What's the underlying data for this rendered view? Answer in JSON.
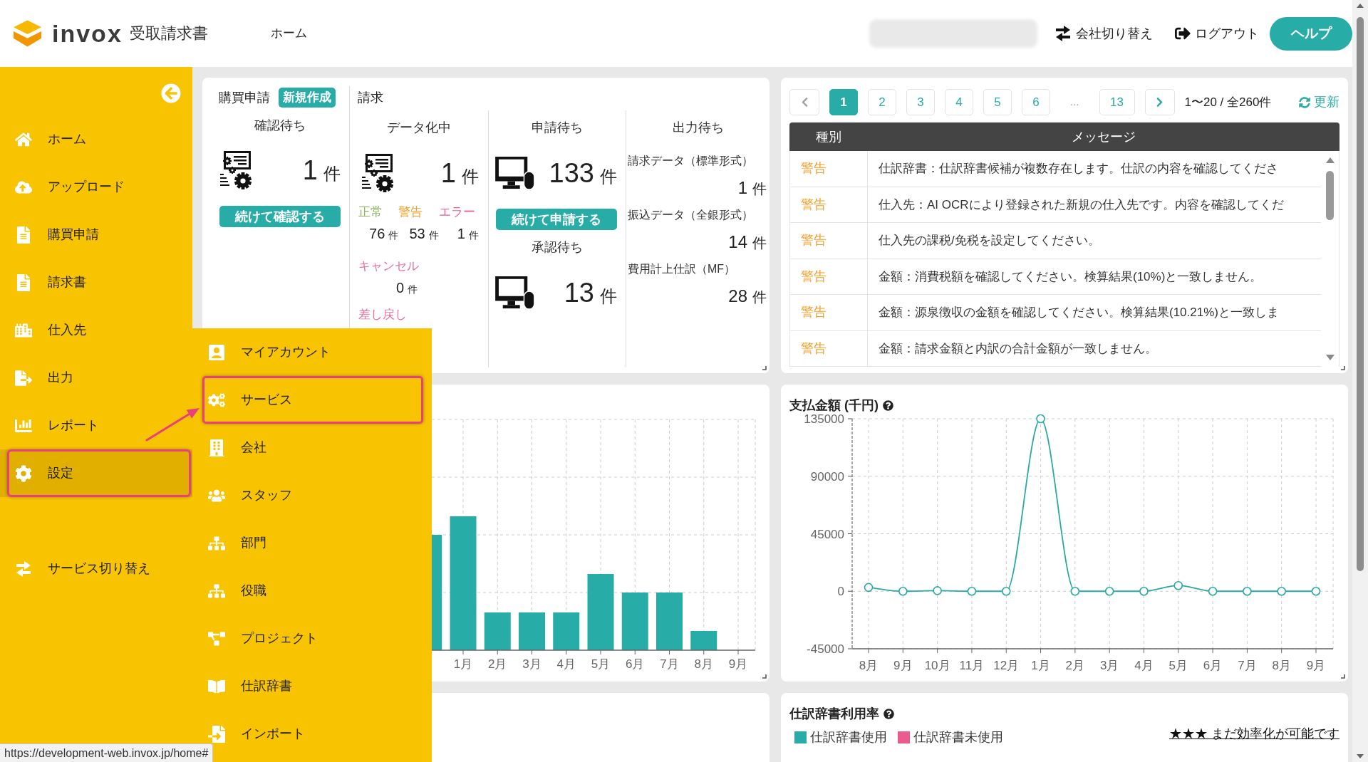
{
  "header": {
    "logo": {
      "wordmark": "invox",
      "product": "受取請求書"
    },
    "nav": [
      {
        "label": "ホーム"
      }
    ],
    "actions": [
      {
        "kind": "switch",
        "label": "会社切り替え"
      },
      {
        "kind": "logout",
        "label": "ログアウト"
      }
    ],
    "help_button": "ヘルプ"
  },
  "sidebar": {
    "items": [
      {
        "label": "ホーム",
        "selected": false,
        "highlighted": false
      },
      {
        "label": "アップロード",
        "selected": false,
        "highlighted": false
      },
      {
        "label": "購買申請",
        "selected": false,
        "highlighted": false
      },
      {
        "label": "請求書",
        "selected": false,
        "highlighted": false
      },
      {
        "label": "仕入先",
        "selected": false,
        "highlighted": false
      },
      {
        "label": "出力",
        "selected": false,
        "highlighted": false
      },
      {
        "label": "レポート",
        "selected": false,
        "highlighted": false
      },
      {
        "label": "設定",
        "selected": true,
        "highlighted": true
      }
    ],
    "bottom_items": [
      {
        "label": "サービス切り替え",
        "selected": false,
        "highlighted": false
      }
    ]
  },
  "submenu": {
    "items": [
      {
        "label": "マイアカウント",
        "highlighted": false
      },
      {
        "label": "サービス",
        "highlighted": true
      },
      {
        "label": "会社",
        "highlighted": false
      },
      {
        "label": "スタッフ",
        "highlighted": false
      },
      {
        "label": "部門",
        "highlighted": false
      },
      {
        "label": "役職",
        "highlighted": false
      },
      {
        "label": "プロジェクト",
        "highlighted": false
      },
      {
        "label": "仕訳辞書",
        "highlighted": false
      },
      {
        "label": "インポート",
        "highlighted": false
      }
    ]
  },
  "summary": {
    "purchase": {
      "title": "購買申請",
      "new_button": "新規作成",
      "column": {
        "heading": "確認待ち",
        "count": "1",
        "unit": "件",
        "button": "続けて確認する"
      }
    },
    "invoice": {
      "title": "請求",
      "columns": [
        {
          "kind": "digitizing",
          "heading": "データ化中",
          "count": "1",
          "unit": "件",
          "statuses": [
            {
              "label": "正常",
              "count": "76",
              "unit": "件",
              "color": "#8ab35c"
            },
            {
              "label": "警告",
              "count": "53",
              "unit": "件",
              "color": "#f0a02a"
            },
            {
              "label": "エラー",
              "count": "1",
              "unit": "件",
              "color": "#e95a8e"
            }
          ],
          "others": [
            {
              "label": "キャンセル",
              "count": "0",
              "unit": "件"
            },
            {
              "label": "差し戻し"
            }
          ]
        },
        {
          "kind": "applying",
          "heading": "申請待ち",
          "count": "133",
          "unit": "件",
          "button": "続けて申請する",
          "sub": {
            "heading": "承認待ち",
            "count": "13",
            "unit": "件"
          }
        },
        {
          "kind": "output",
          "heading": "出力待ち",
          "outputs": [
            {
              "label": "請求データ（標準形式）",
              "count": "1",
              "unit": "件"
            },
            {
              "label": "振込データ（全銀形式）",
              "count": "14",
              "unit": "件"
            },
            {
              "label": "費用計上仕訳（MF）",
              "count": "28",
              "unit": "件"
            }
          ]
        }
      ]
    }
  },
  "messages": {
    "pagination": {
      "prev": {
        "disabled": true
      },
      "pages": [
        {
          "label": "1",
          "selected": true
        },
        {
          "label": "2",
          "selected": false
        },
        {
          "label": "3",
          "selected": false
        },
        {
          "label": "4",
          "selected": false
        },
        {
          "label": "5",
          "selected": false
        },
        {
          "label": "6",
          "selected": false
        }
      ],
      "ellipsis": "...",
      "last_pages": [
        {
          "label": "13",
          "selected": false
        }
      ],
      "next": {
        "disabled": false
      },
      "range": "1〜20 / 全260件",
      "refresh": "更新"
    },
    "columns": [
      "種別",
      "メッセージ"
    ],
    "rows": [
      {
        "type": "警告",
        "message": "仕訳辞書：仕訳辞書候補が複数存在します。仕訳の内容を確認してくださ"
      },
      {
        "type": "警告",
        "message": "仕入先：AI OCRにより登録された新規の仕入先です。内容を確認してくだ"
      },
      {
        "type": "警告",
        "message": "仕入先の課税/免税を設定してください。"
      },
      {
        "type": "警告",
        "message": "金額：消費税額を確認してください。検算結果(10%)と一致しません。"
      },
      {
        "type": "警告",
        "message": "金額：源泉徴収の金額を確認してください。検算結果(10.21%)と一致しま"
      },
      {
        "type": "警告",
        "message": "金額：請求金額と内訳の合計金額が一致しません。"
      }
    ]
  },
  "monthly_chart": {
    "x_labels": [
      "1月",
      "2月",
      "3月",
      "4月",
      "5月",
      "6月",
      "7月",
      "8月",
      "9月"
    ]
  },
  "payment_chart": {
    "title": "支払金額 (千円)",
    "chart_data": {
      "type": "line",
      "categories": [
        "8月",
        "9月",
        "10月",
        "11月",
        "12月",
        "1月",
        "2月",
        "3月",
        "4月",
        "5月",
        "6月",
        "7月",
        "8月",
        "9月"
      ],
      "series": [
        {
          "color": "#2aa9a3",
          "marker": "circle",
          "values": [
            3000,
            0,
            500,
            0,
            0,
            135000,
            0,
            0,
            0,
            4500,
            0,
            0,
            0,
            0
          ]
        }
      ],
      "ylim": [
        -45000,
        135000
      ],
      "yticks": [
        -45000,
        0,
        45000,
        90000,
        135000
      ],
      "grid": true
    }
  },
  "dictionary_usage": {
    "title": "仕訳辞書利用率",
    "legend": [
      {
        "label": "仕訳辞書使用",
        "color": "#27aca8"
      },
      {
        "label": "仕訳辞書未使用",
        "color": "#ec5b8d"
      }
    ],
    "link": "★★★ まだ効率化が可能です"
  },
  "status_url": "https://development-web.invox.jp/home#"
}
